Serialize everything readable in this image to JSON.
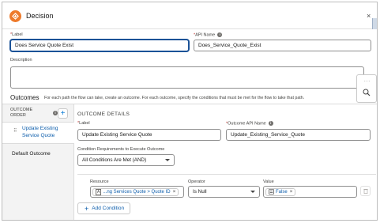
{
  "header": {
    "title": "Decision",
    "close_glyph": "×",
    "icon": "decision-icon"
  },
  "label_field": {
    "label": "Label",
    "value": "Does Service Quote Exist"
  },
  "api_field": {
    "label": "API Name",
    "value": "Does_Service_Quote_Exist"
  },
  "description": {
    "label": "Description",
    "value": ""
  },
  "side_panel": {
    "dots": "...",
    "search_icon": "search-icon"
  },
  "outcomes": {
    "title": "Outcomes",
    "description": "For each path the flow can take, create an outcome. For each outcome, specify the conditions that must be met for the flow to take that path."
  },
  "outcome_order": {
    "header_line1": "OUTCOME",
    "header_line2": "ORDER",
    "add_glyph": "+",
    "selected_item": "Update Existing Service Quote",
    "default_item": "Default Outcome"
  },
  "outcome_details": {
    "title": "OUTCOME DETAILS",
    "label_caption": "Label",
    "label_value": "Update Existing Service Quote",
    "api_caption": "Outcome API Name",
    "api_value": "Update_Existing_Service_Quote",
    "condition_caption": "Condition Requirements to Execute Outcome",
    "condition_value": "All Conditions Are Met (AND)"
  },
  "condition_row": {
    "resource_caption": "Resource",
    "resource_value": "...ng Services Quote > Quote ID",
    "operator_caption": "Operator",
    "operator_value": "Is Null",
    "value_caption": "Value",
    "value_value": "False"
  },
  "add_condition_label": "Add Condition",
  "colors": {
    "accent": "#0176d3",
    "brand_orange": "#ee7a2b",
    "link": "#0b5cab"
  }
}
